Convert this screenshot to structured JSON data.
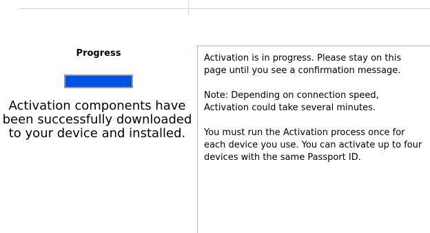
{
  "progress": {
    "title": "Progress",
    "fraction": 1.0,
    "fill_color": "#0052e6"
  },
  "status": {
    "message": "Activation components have been successfully downloaded to your device and installed."
  },
  "info": {
    "paragraphs": [
      "Activation is in progress. Please stay on this page until you see a confirmation message.",
      "Note: Depending on connection speed, Activation could take several minutes.",
      "You must run the Activation process once for each device you use. You can activate up to four devices with the same Passport ID."
    ]
  }
}
